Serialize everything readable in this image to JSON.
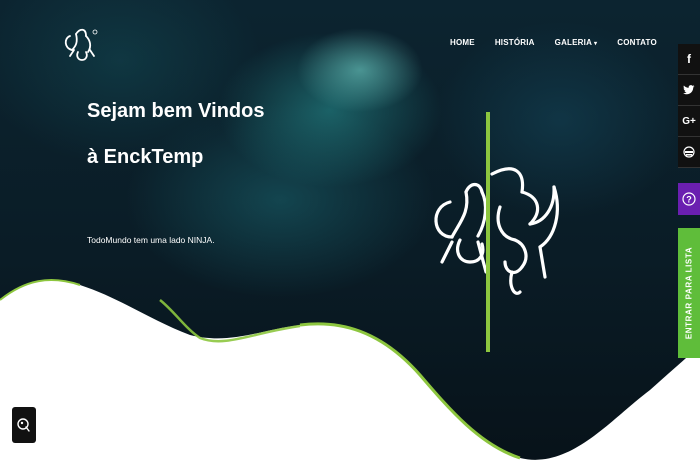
{
  "nav": {
    "items": [
      {
        "label": "HOME"
      },
      {
        "label": "HISTÓRIA"
      },
      {
        "label": "GALERIA",
        "has_dropdown": true
      },
      {
        "label": "CONTATO"
      }
    ]
  },
  "hero": {
    "headline_line1": "Sejam bem Vindos",
    "headline_line2": "à EnckTemp",
    "tagline": "TodoMundo tem uma lado NINJA."
  },
  "social": {
    "facebook": "f",
    "twitter": "t",
    "google": "G+"
  },
  "side_tab": {
    "label": "ENTRAR PARA LISTA"
  },
  "colors": {
    "accent_green": "#8dc63f",
    "help_purple": "#6a1fb0",
    "list_green": "#5fbd3a",
    "hero_dark": "#0a1c26"
  },
  "icons": [
    "logo-emblem",
    "facebook-icon",
    "twitter-icon",
    "google-plus-icon",
    "helmet-icon",
    "question-icon",
    "chat-icon"
  ]
}
